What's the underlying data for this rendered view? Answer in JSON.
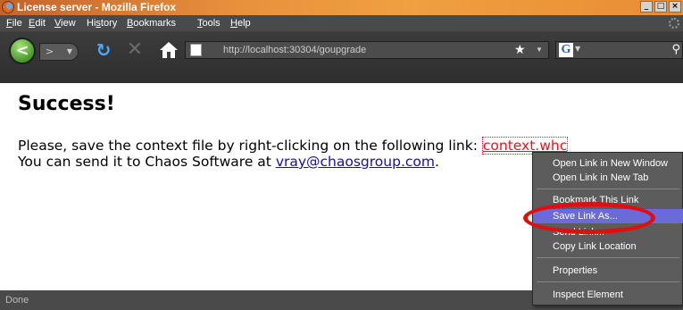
{
  "window": {
    "title": "License server - Mozilla Firefox",
    "controls": [
      "_",
      "□",
      "×"
    ]
  },
  "menubar": {
    "items": [
      {
        "mnemonic": "F",
        "rest": "ile"
      },
      {
        "mnemonic": "E",
        "rest": "dit"
      },
      {
        "mnemonic": "V",
        "rest": "iew"
      },
      {
        "mnemonic": "",
        "pre": "Hi",
        "mid": "s",
        "rest": "tory"
      },
      {
        "mnemonic": "B",
        "rest": "ookmarks"
      },
      {
        "mnemonic": "T",
        "rest": "ools"
      },
      {
        "mnemonic": "H",
        "rest": "elp"
      }
    ]
  },
  "toolbar": {
    "back_glyph": "<",
    "forward_glyph": ">",
    "url": "http://localhost:30304/goupgrade",
    "search_engine_letter": "G"
  },
  "page": {
    "heading": "Success!",
    "line1_text": "Please, save the context file by right-clicking on the following link: ",
    "context_link": "context.whc",
    "line2_text": "You can send it to Chaos Software at ",
    "email_link": "vray@chaosgroup.com",
    "line2_end": "."
  },
  "status": {
    "text": "Done"
  },
  "context_menu": {
    "items": [
      {
        "label": "Open Link in New Window"
      },
      {
        "label": "Open Link in New Tab"
      },
      {
        "label": "Bookmark This Link"
      },
      {
        "label": "Save Link As...",
        "highlighted": true
      },
      {
        "label": "Send Link..."
      },
      {
        "label": "Copy Link Location"
      },
      {
        "label": "Properties"
      },
      {
        "label": "Inspect Element"
      }
    ]
  },
  "colors": {
    "highlight": "#6a6ad8",
    "annotation": "#e10e0e",
    "link": "#1a0dab",
    "context_link": "#e8141e"
  }
}
